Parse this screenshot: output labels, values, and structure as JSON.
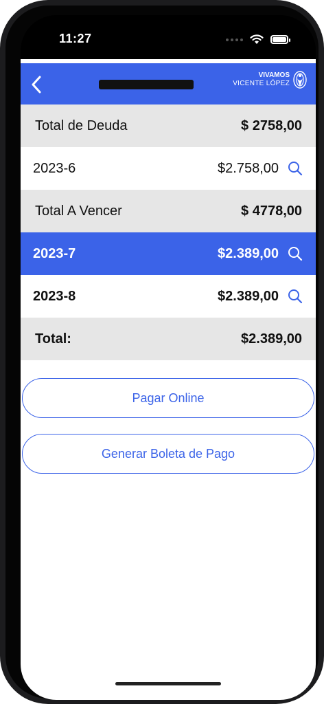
{
  "status_bar": {
    "time": "11:27"
  },
  "navbar": {
    "title": "",
    "logo_line1": "VIVAMOS",
    "logo_line2": "VICENTE LÓPEZ"
  },
  "rows": [
    {
      "label": "Total de Deuda",
      "amount": "$ 2758,00"
    },
    {
      "label": "2023-6",
      "amount": "$2.758,00"
    },
    {
      "label": "Total A Vencer",
      "amount": "$ 4778,00"
    },
    {
      "label": "2023-7",
      "amount": "$2.389,00"
    },
    {
      "label": "2023-8",
      "amount": "$2.389,00"
    },
    {
      "label": "Total:",
      "amount": "$2.389,00"
    }
  ],
  "buttons": {
    "pay_online": "Pagar Online",
    "generate_slip": "Generar Boleta de Pago"
  },
  "colors": {
    "accent": "#3b63e8",
    "row_grey": "#e6e6e6"
  }
}
